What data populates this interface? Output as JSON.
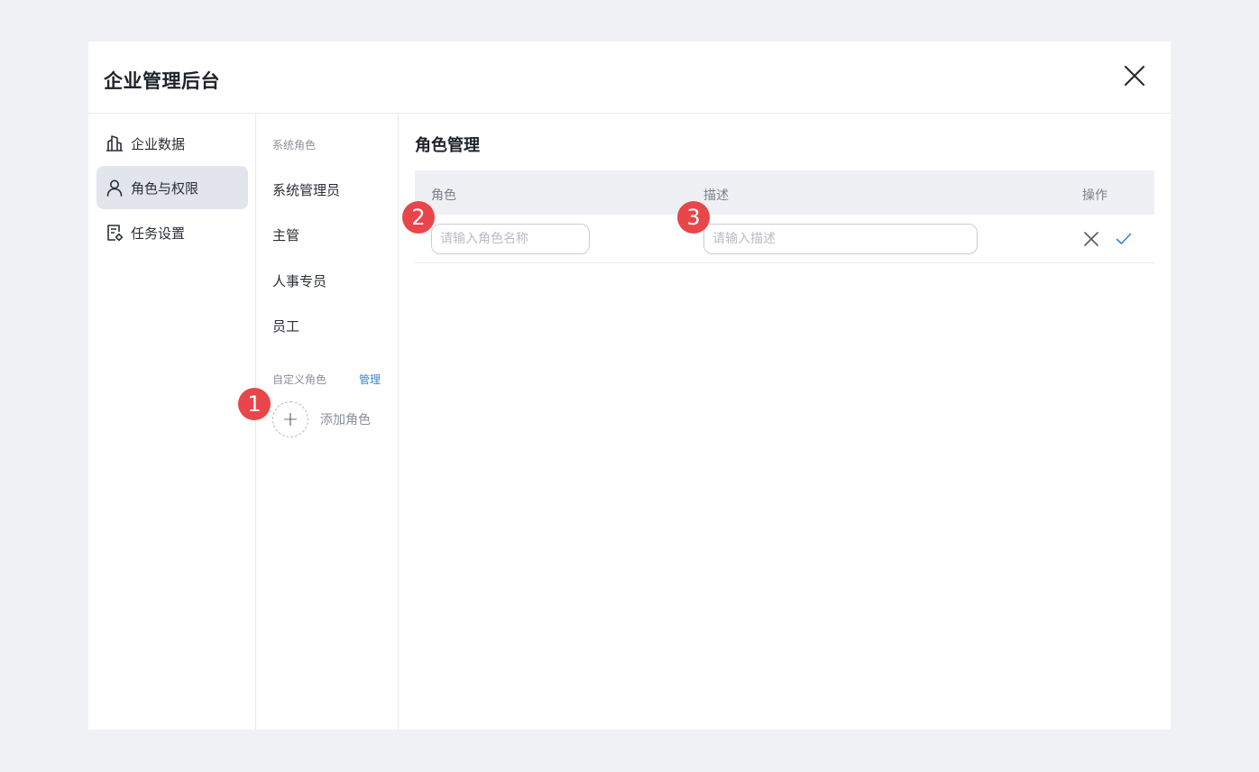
{
  "app": {
    "title": "企业管理后台"
  },
  "nav": {
    "items": [
      {
        "label": "企业数据",
        "icon": "building-icon",
        "active": false
      },
      {
        "label": "角色与权限",
        "icon": "user-icon",
        "active": true
      },
      {
        "label": "任务设置",
        "icon": "task-settings-icon",
        "active": false
      }
    ]
  },
  "roles": {
    "system_label": "系统角色",
    "system_roles": [
      "系统管理员",
      "主管",
      "人事专员",
      "员工"
    ],
    "custom_label": "自定义角色",
    "manage_label": "管理",
    "add_label": "添加角色",
    "add_symbol": "+"
  },
  "main": {
    "title": "角色管理",
    "columns": {
      "role": "角色",
      "description": "描述",
      "actions": "操作"
    },
    "new_row": {
      "role_placeholder": "请输入角色名称",
      "description_placeholder": "请输入描述"
    }
  },
  "badges": [
    "1",
    "2",
    "3"
  ],
  "colors": {
    "accent": "#3b82d6",
    "badge": "#e8464a",
    "active_nav": "#e2e5ec",
    "background": "#f0f1f5"
  }
}
